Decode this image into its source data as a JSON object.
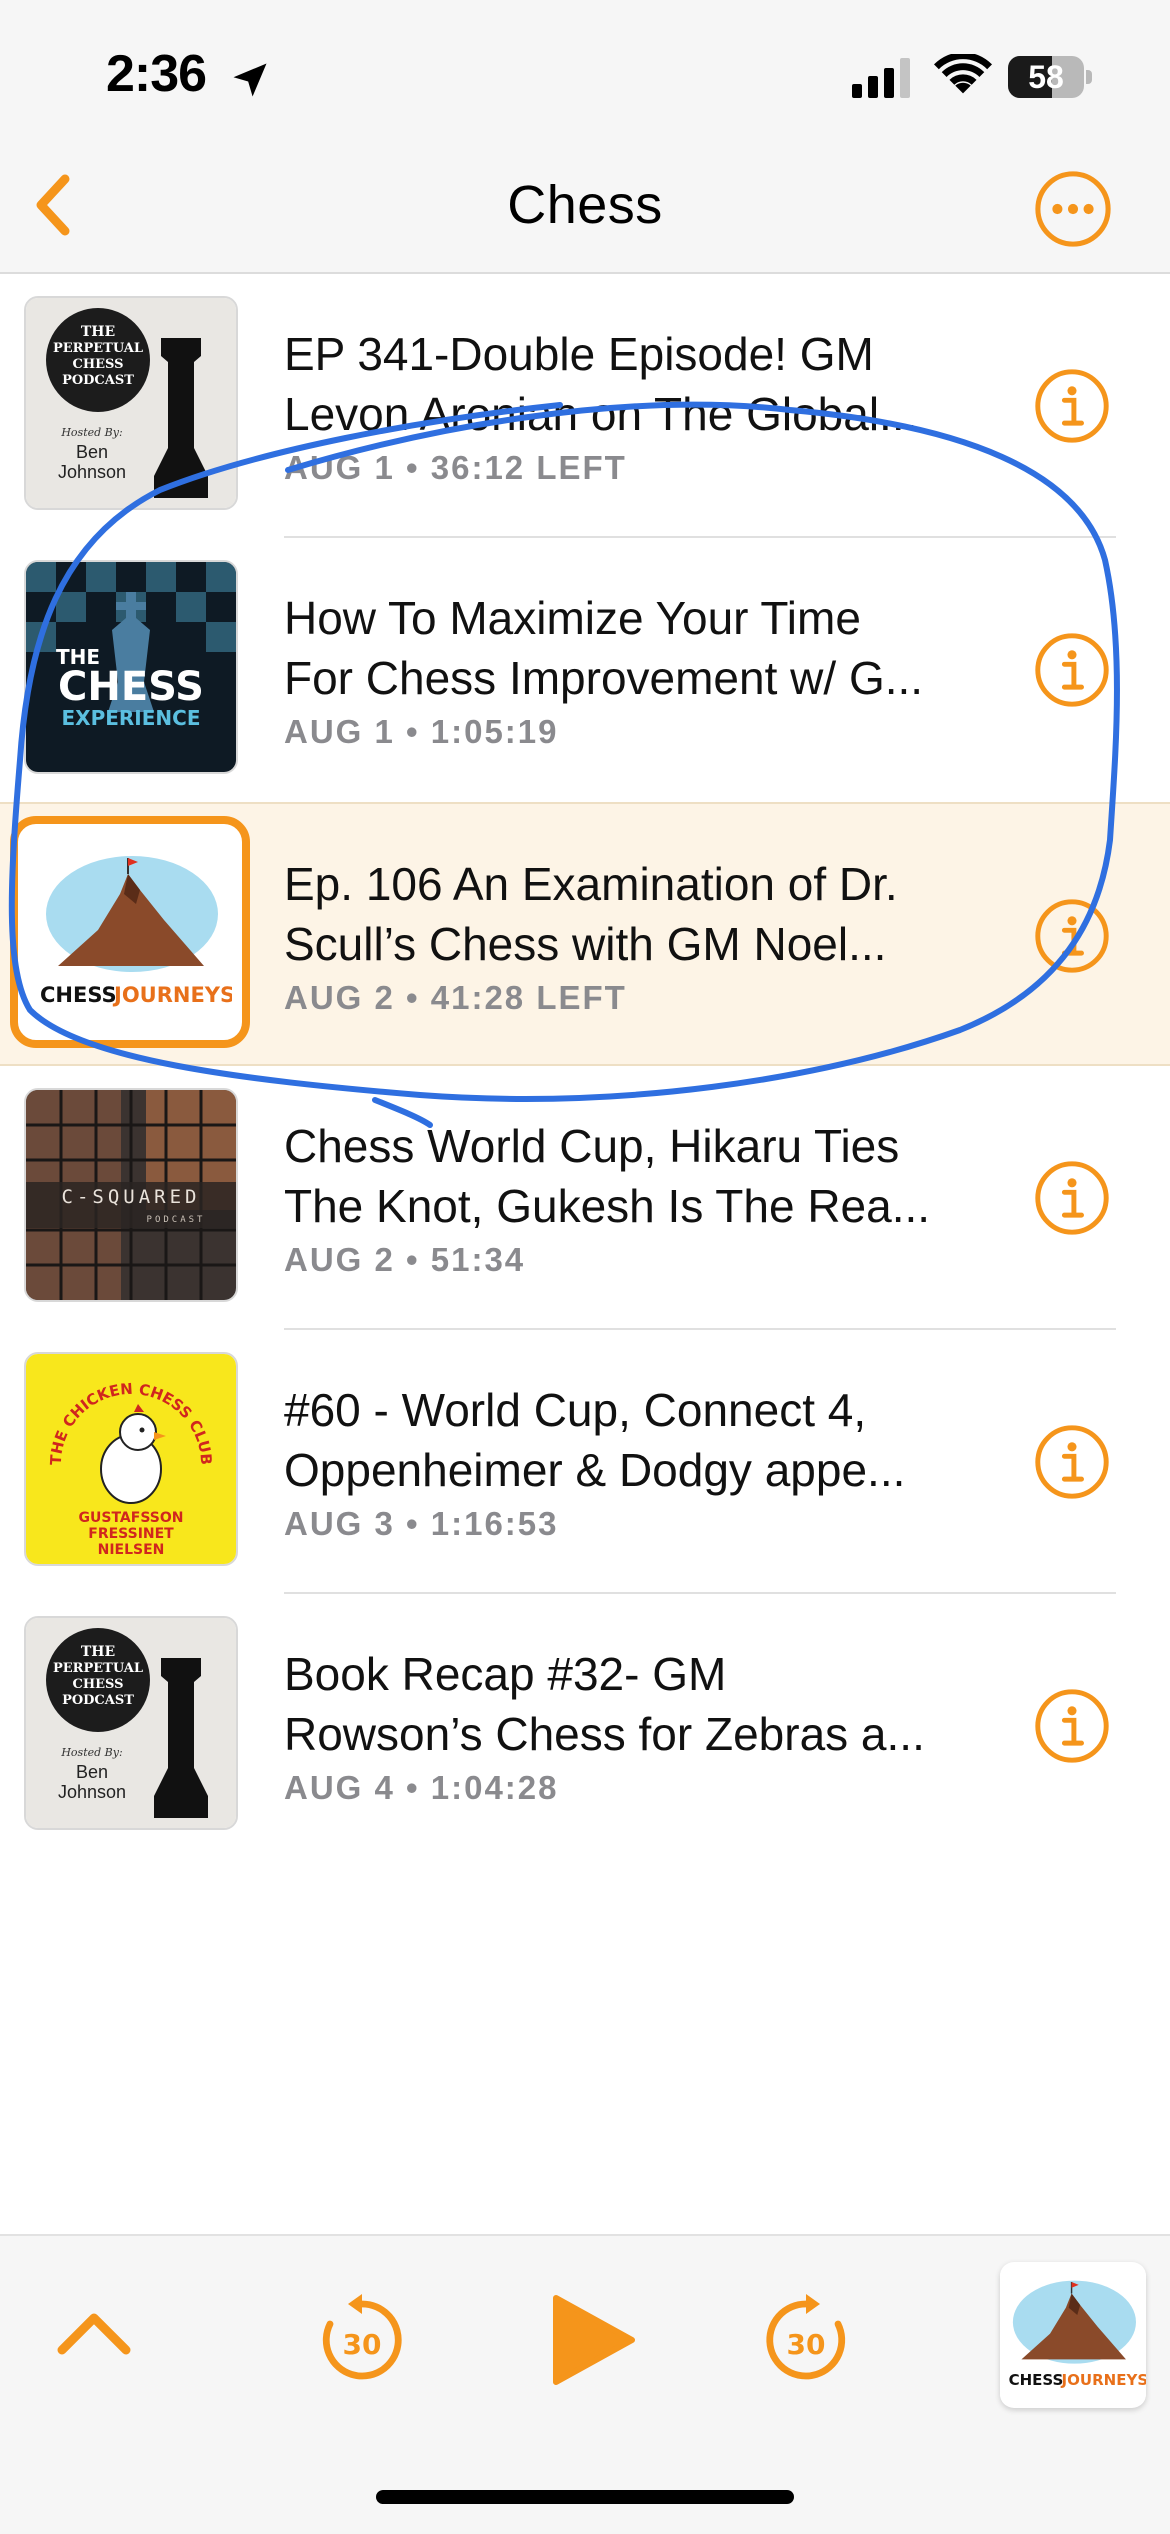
{
  "status_bar": {
    "time": "2:36",
    "battery": "58",
    "battery_level": 0.58
  },
  "nav": {
    "title": "Chess"
  },
  "episodes": [
    {
      "title_line1": "EP 341-Double Episode! GM",
      "title_line2": "Levon Aronian on The Global...",
      "date": "AUG 1",
      "duration": "36:12 LEFT",
      "artwork": {
        "line1": "THE",
        "line2": "PERPETUAL",
        "line3": "CHESS",
        "line4": "PODCAST",
        "hosted": "Hosted By:",
        "host1": "Ben",
        "host2": "Johnson"
      }
    },
    {
      "title_line1": "How To Maximize Your Time",
      "title_line2": "For Chess Improvement w/ G...",
      "date": "AUG 1",
      "duration": "1:05:19",
      "artwork": {
        "line1": "THE",
        "line2": "CHESS",
        "line3": "EXPERIENCE"
      }
    },
    {
      "title_line1": "Ep. 106 An Examination of Dr.",
      "title_line2": "Scull’s Chess with GM Noel...",
      "date": "AUG 2",
      "duration": "41:28 LEFT",
      "artwork": {
        "brand_a": "CHESS",
        "brand_b": "JOURNEYS"
      }
    },
    {
      "title_line1": "Chess World Cup, Hikaru Ties",
      "title_line2": "The Knot, Gukesh Is The Rea...",
      "date": "AUG 2",
      "duration": "51:34",
      "artwork": {
        "line1": "C-SQUARED",
        "line2": "PODCAST"
      }
    },
    {
      "title_line1": "#60 - World Cup, Connect 4,",
      "title_line2": "Oppenheimer & Dodgy appe...",
      "date": "AUG 3",
      "duration": "1:16:53",
      "artwork": {
        "line1": "THE CHICKEN CHESS CLUB",
        "host1": "GUSTAFSSON",
        "host2": "FRESSINET",
        "host3": "NIELSEN"
      }
    },
    {
      "title_line1": "Book Recap #32- GM",
      "title_line2": "Rowson’s Chess for Zebras a...",
      "date": "AUG 4",
      "duration": "1:04:28",
      "artwork": {
        "line1": "THE",
        "line2": "PERPETUAL",
        "line3": "CHESS",
        "line4": "PODCAST",
        "hosted": "Hosted By:",
        "host1": "Ben",
        "host2": "Johnson"
      }
    }
  ],
  "player": {
    "skip_back": "30",
    "skip_forward": "30",
    "artwork": {
      "brand_a": "CHESS",
      "brand_b": "JOURNEYS"
    }
  },
  "colors": {
    "accent": "#f5951b",
    "annotation": "#2f6fe0",
    "highlight": "#fdf4e6",
    "meta": "#8a8a8e"
  }
}
